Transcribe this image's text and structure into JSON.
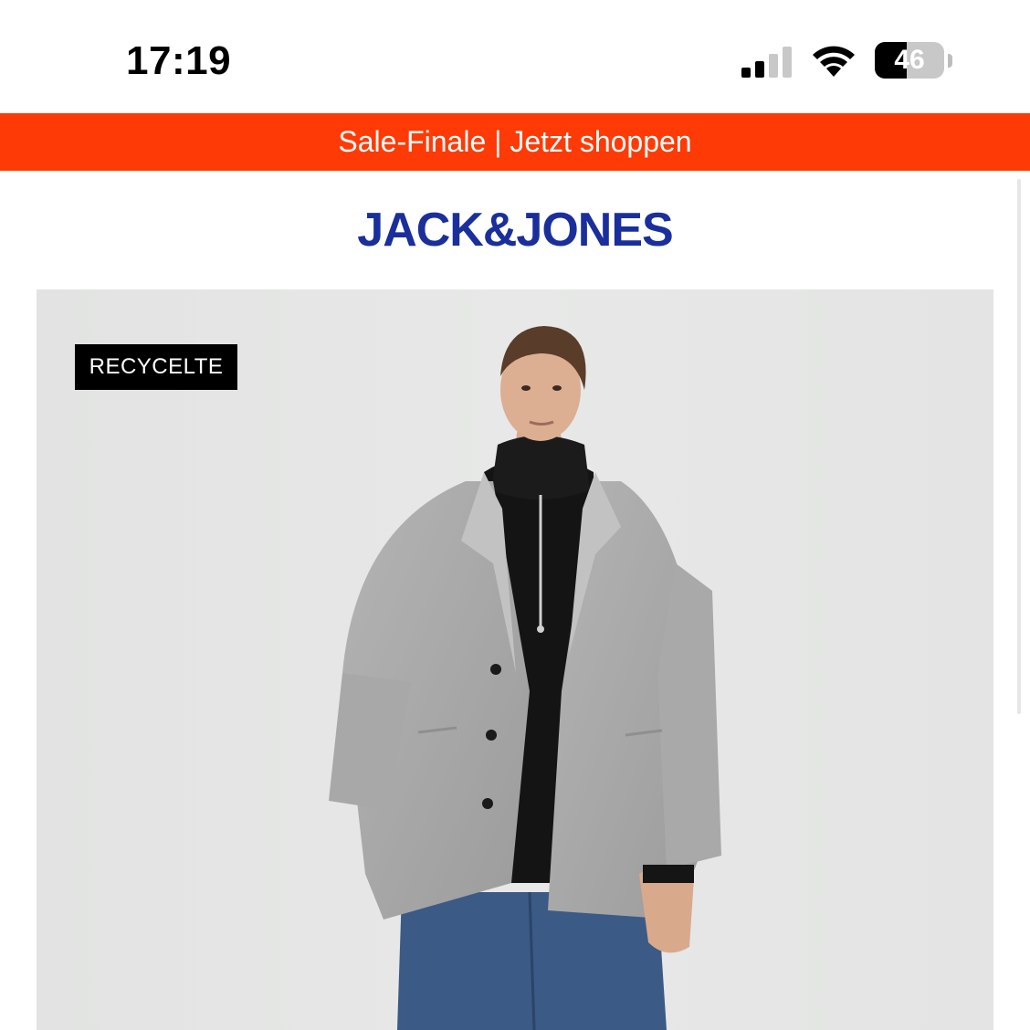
{
  "status_bar": {
    "time": "17:19",
    "battery_level": "46",
    "battery_fraction": 0.46,
    "signal_icon": "cellular-signal-icon",
    "wifi_icon": "wifi-icon"
  },
  "promo_banner": {
    "text": "Sale-Finale | Jetzt shoppen",
    "color": "#fe3a06"
  },
  "brand": {
    "logo_text": "JACK&JONES",
    "color": "#1a2f9c"
  },
  "product": {
    "badge": "RECYCELTE",
    "image_description_icon": "product-photo"
  }
}
